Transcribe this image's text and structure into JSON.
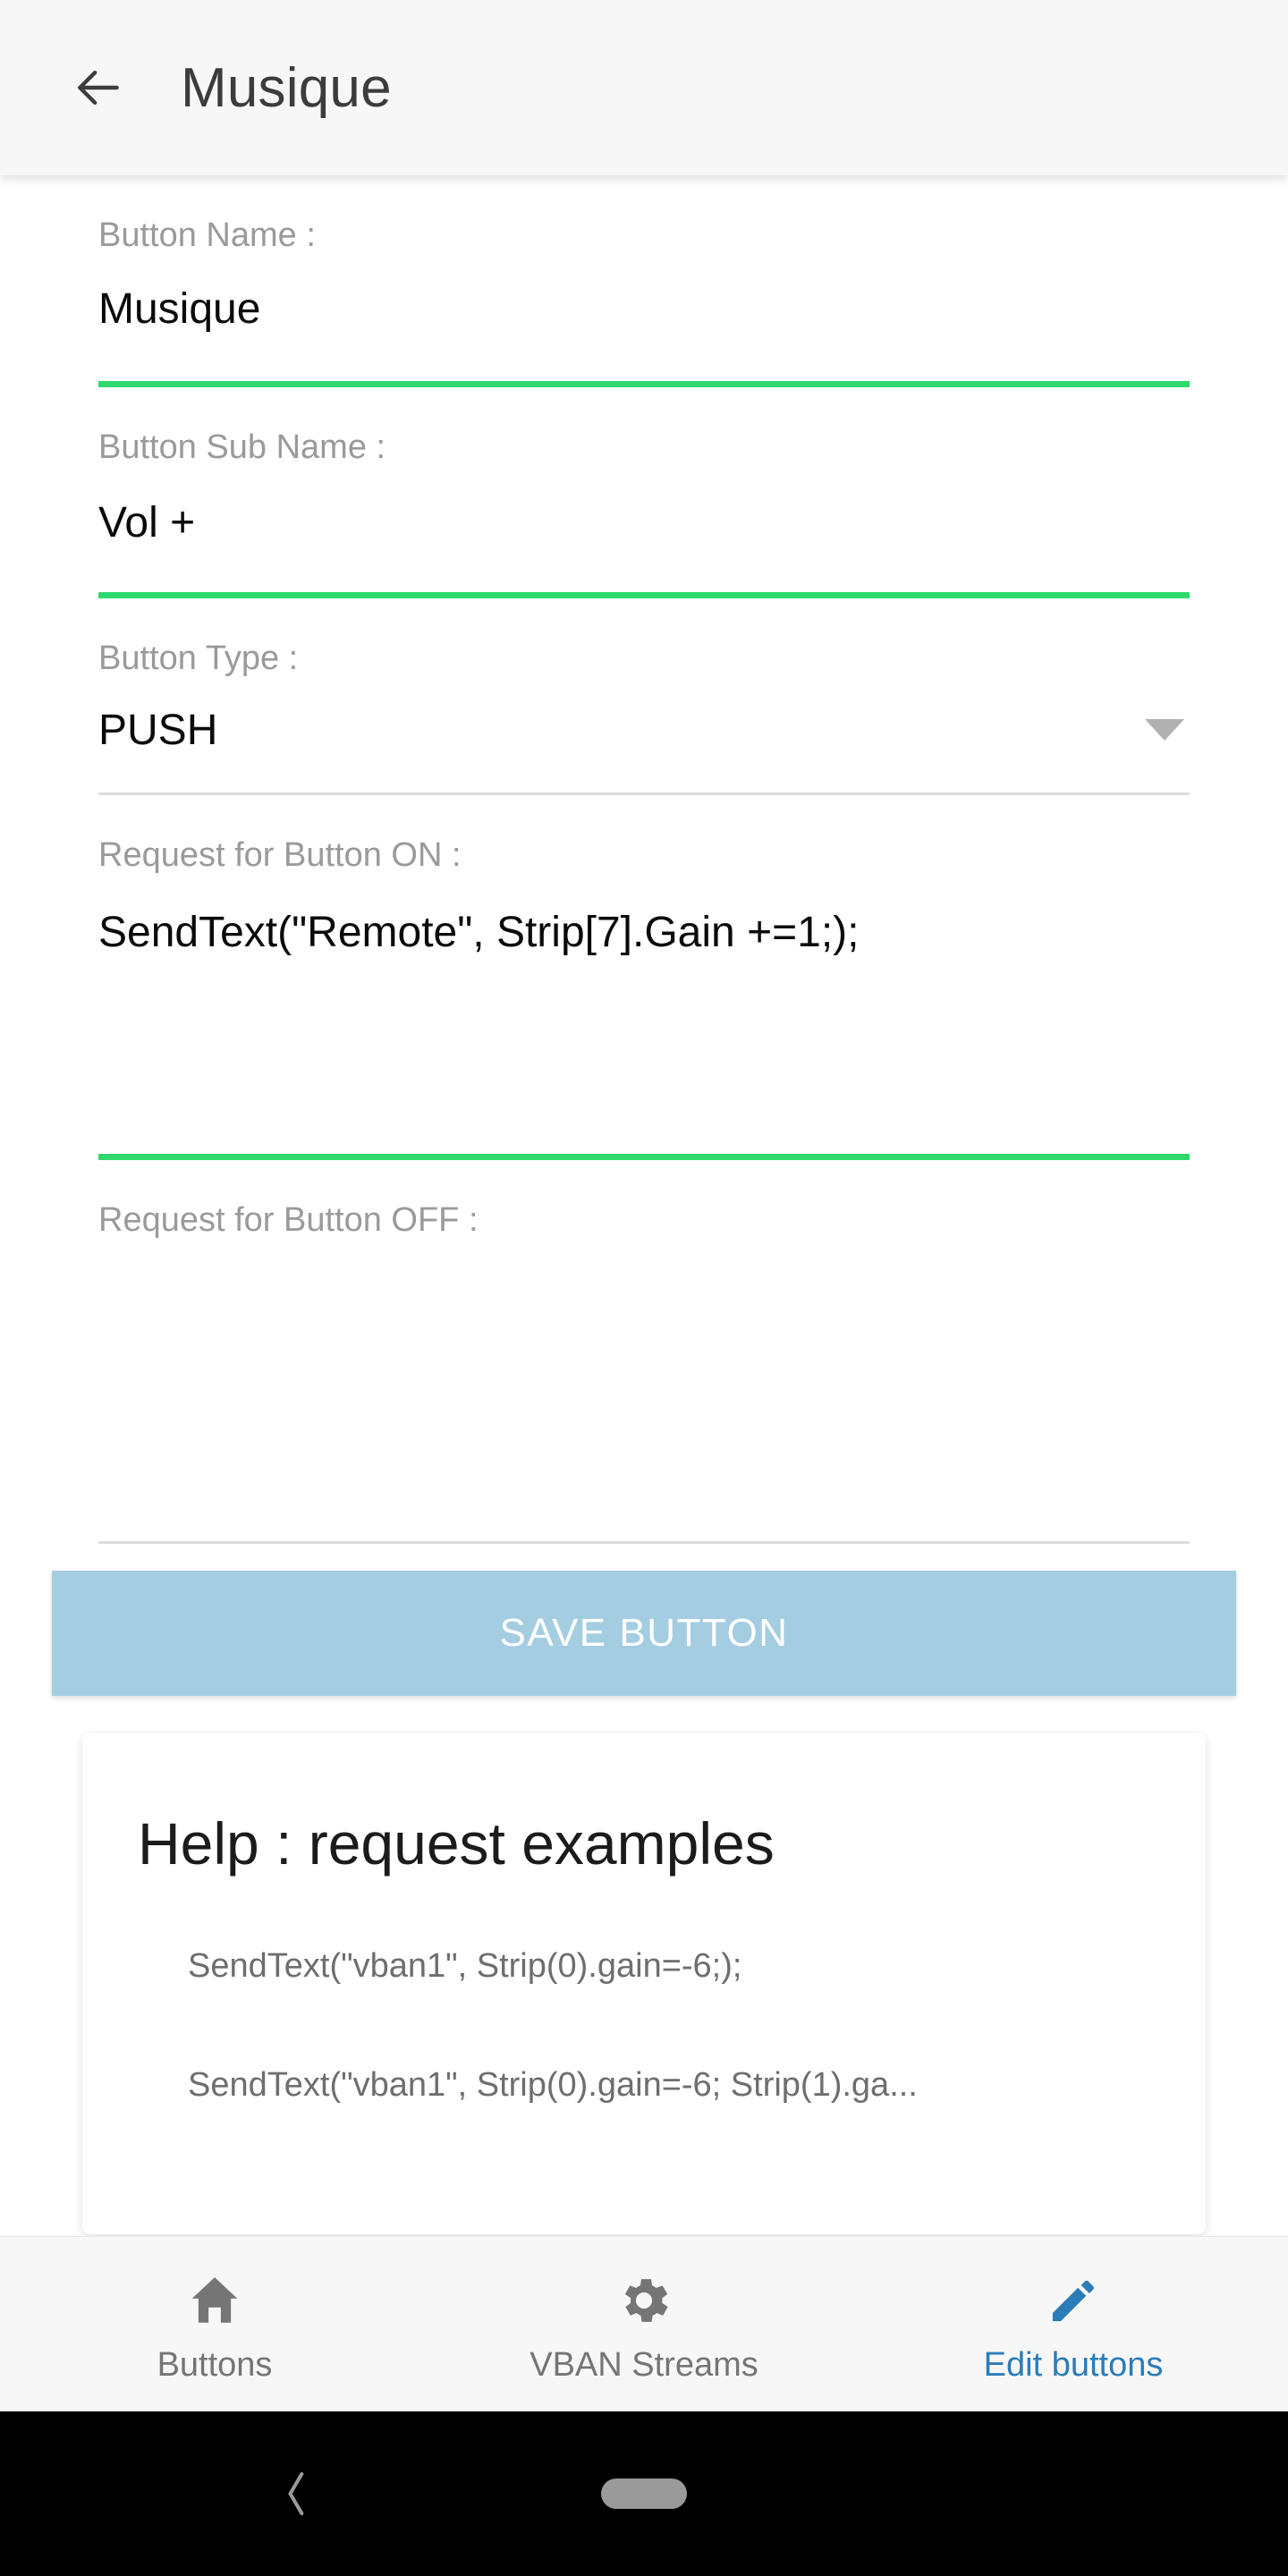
{
  "appbar": {
    "back_icon": "arrow-left-icon",
    "title": "Musique"
  },
  "form": {
    "fields": [
      {
        "label": "Button Name :",
        "value": "Musique",
        "underline": "green"
      },
      {
        "label": "Button Sub Name :",
        "value": "Vol +",
        "underline": "green"
      },
      {
        "label": "Button Type :",
        "value": "PUSH",
        "underline": "gray",
        "caret_icon": "chevron-down-icon"
      },
      {
        "label": "Request for Button ON :",
        "value": "SendText(\"Remote\", Strip[7].Gain +=1;);",
        "underline": "green"
      },
      {
        "label": "Request for Button OFF :",
        "value": "",
        "underline": "gray"
      }
    ]
  },
  "save": {
    "label": "SAVE BUTTON"
  },
  "help": {
    "title": "Help : request examples",
    "examples": [
      "SendText(\"vban1\", Strip(0).gain=-6;);",
      "SendText(\"vban1\", Strip(0).gain=-6; Strip(1).ga..."
    ]
  },
  "bottom_nav": {
    "items": [
      {
        "label": "Buttons",
        "icon": "home-icon",
        "active": false
      },
      {
        "label": "VBAN Streams",
        "icon": "gear-icon",
        "active": false
      },
      {
        "label": "Edit buttons",
        "icon": "pencil-icon",
        "active": true
      }
    ]
  },
  "system_nav": {
    "back_icon": "chevron-left-icon",
    "home_pill": "home-pill-indicator"
  },
  "colors": {
    "accent_green": "#2fd96e",
    "save_blue": "#a4cde2",
    "active_blue": "#2b7cb8",
    "appbar_bg": "#f7f7f7",
    "label_gray": "#9a9a9a"
  }
}
